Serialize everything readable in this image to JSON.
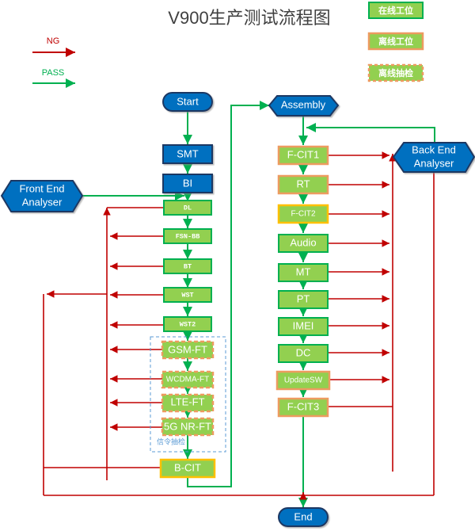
{
  "title": "V900生产测试流程图",
  "legend": {
    "ng": {
      "label": "NG",
      "color": "#c00000"
    },
    "pass": {
      "label": "PASS",
      "color": "#00b050"
    },
    "boxes": [
      {
        "label": "在线工位",
        "border": "#00b050",
        "fill": "#92d050",
        "style": "solid"
      },
      {
        "label": "离线工位",
        "border": "#ed9b60",
        "fill": "#92d050",
        "style": "solid"
      },
      {
        "label": "离线抽检",
        "border": "#ed9b60",
        "fill": "#92d050",
        "style": "dashed"
      }
    ]
  },
  "colors": {
    "blue_fill": "#0070c0",
    "blue_stroke": "#1f3864",
    "green_fill": "#92d050",
    "green_stroke": "#00b050",
    "orange_stroke": "#ed9b60",
    "yellow_stroke": "#ffc000",
    "ng": "#c00000",
    "pass": "#00b050",
    "dash_box": "#5b9bd5"
  },
  "terminals": {
    "start": "Start",
    "end": "End",
    "assembly": "Assembly",
    "front_end": "Front End Analyser",
    "back_end": "Back End Analyser"
  },
  "left_column": [
    {
      "label": "SMT",
      "kind": "blue"
    },
    {
      "label": "BI",
      "kind": "blue"
    },
    {
      "label": "DL",
      "kind": "online-sm"
    },
    {
      "label": "FSN-BB",
      "kind": "online-sm"
    },
    {
      "label": "BT",
      "kind": "online-sm"
    },
    {
      "label": "WST",
      "kind": "online-sm"
    },
    {
      "label": "WST2",
      "kind": "online-sm"
    },
    {
      "label": "GSM-FT",
      "kind": "sample"
    },
    {
      "label": "WCDMA-FT",
      "kind": "sample-xs"
    },
    {
      "label": "LTE-FT",
      "kind": "sample"
    },
    {
      "label": "5G NR-FT",
      "kind": "sample"
    },
    {
      "label": "B-CIT",
      "kind": "yellow"
    }
  ],
  "left_note": "信令抽检",
  "right_column": [
    {
      "label": "F-CIT1",
      "kind": "offline"
    },
    {
      "label": "RT",
      "kind": "offline"
    },
    {
      "label": "F-CIT2",
      "kind": "yellow"
    },
    {
      "label": "Audio",
      "kind": "online"
    },
    {
      "label": "MT",
      "kind": "online"
    },
    {
      "label": "PT",
      "kind": "online"
    },
    {
      "label": "IMEI",
      "kind": "online"
    },
    {
      "label": "DC",
      "kind": "online"
    },
    {
      "label": "UpdateSW",
      "kind": "offline-xs"
    },
    {
      "label": "F-CIT3",
      "kind": "offline"
    }
  ]
}
